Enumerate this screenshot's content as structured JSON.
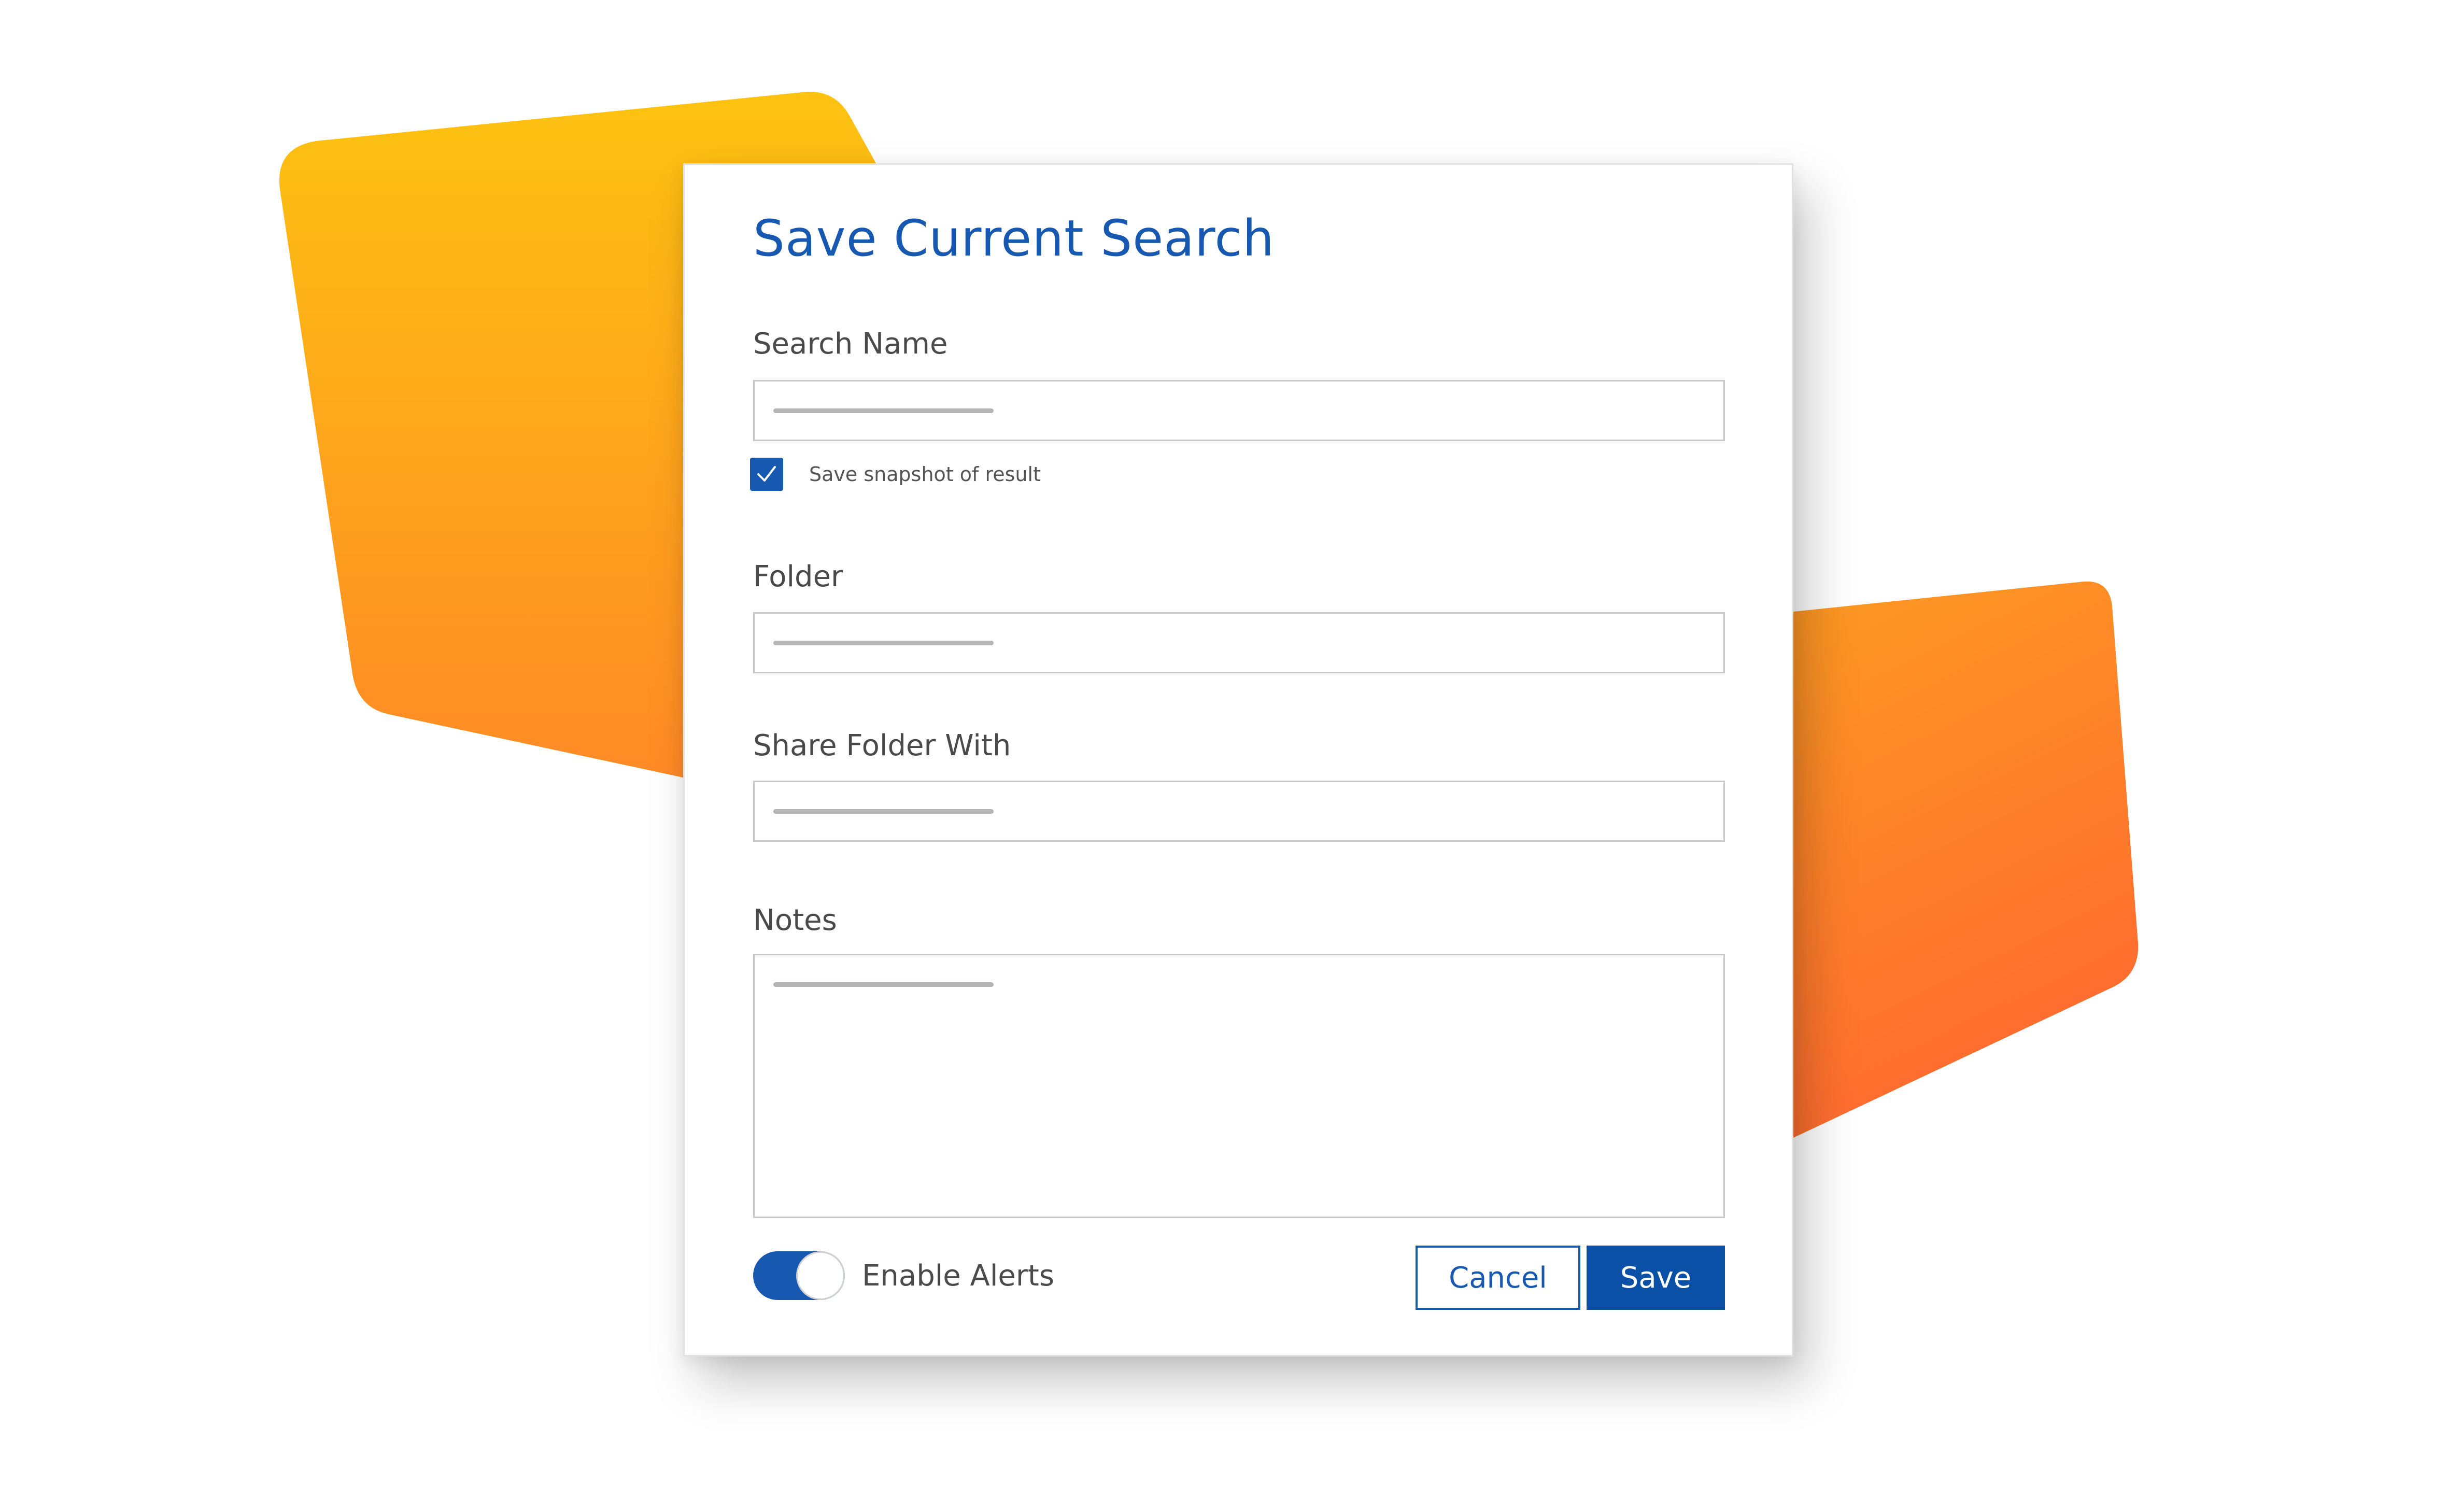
{
  "dialog": {
    "title": "Save Current Search",
    "search_name": {
      "label": "Search Name",
      "value": ""
    },
    "snapshot": {
      "label": "Save snapshot of result",
      "checked": true
    },
    "folder": {
      "label": "Folder",
      "value": ""
    },
    "share": {
      "label": "Share Folder With",
      "value": ""
    },
    "notes": {
      "label": "Notes",
      "value": ""
    },
    "alerts": {
      "label": "Enable Alerts",
      "enabled": true
    },
    "cancel_label": "Cancel",
    "save_label": "Save"
  },
  "colors": {
    "accent": "#1758b0",
    "save_button": "#0b50a7",
    "shape_gradient_top": "#fdbf12",
    "shape_gradient_bottom": "#ff6f2e"
  },
  "icons": {
    "checkbox": "check-icon"
  }
}
